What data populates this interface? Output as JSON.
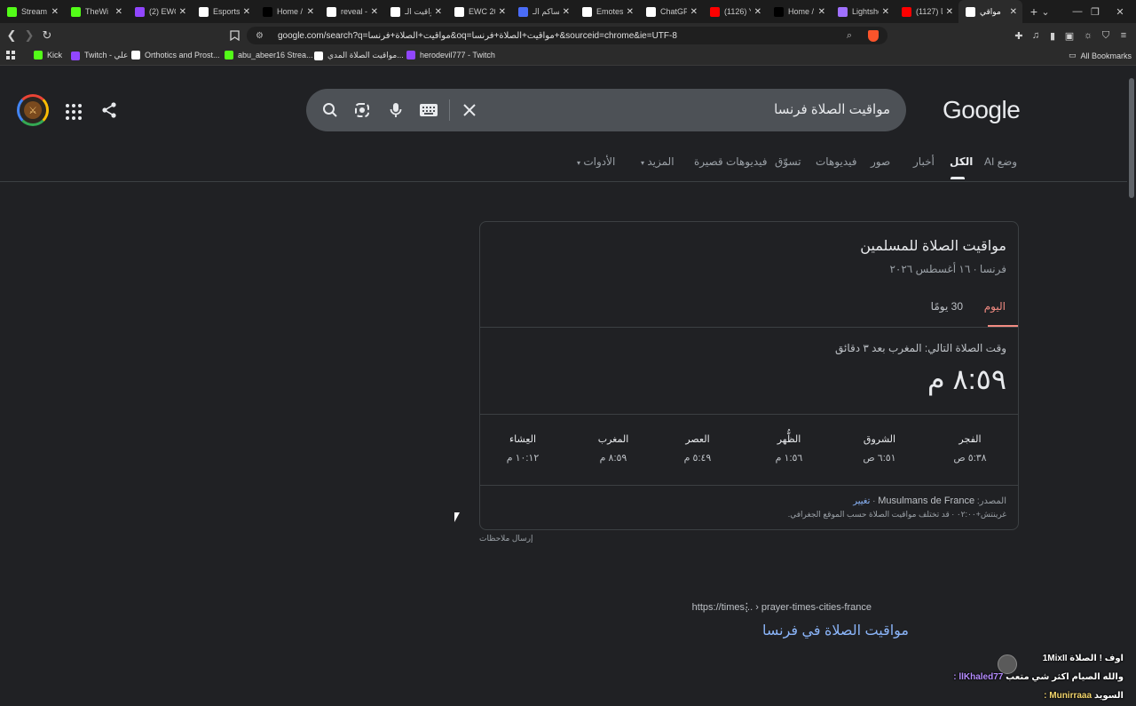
{
  "browser": {
    "tabs": [
      {
        "label": "Stream",
        "color": "#53fc18"
      },
      {
        "label": "TheWi",
        "color": "#53fc18"
      },
      {
        "label": "(2) EWC_s",
        "color": "#9146ff"
      },
      {
        "label": "Esports W",
        "color": "#ffffff"
      },
      {
        "label": "Home / X",
        "color": "#000000"
      },
      {
        "label": "reveal - Li",
        "color": "#ffffff"
      },
      {
        "label": "مواقيت الـ",
        "color": "#ffffff"
      },
      {
        "label": "EWC 2026",
        "color": "#ffffff"
      },
      {
        "label": "مساكم الـ",
        "color": "#4a6cf7"
      },
      {
        "label": "Emotes - I",
        "color": "#ffffff"
      },
      {
        "label": "ChatGPTIn",
        "color": "#ffffff"
      },
      {
        "label": "(1126) You",
        "color": "#ff0000"
      },
      {
        "label": "Home / X",
        "color": "#000000"
      },
      {
        "label": "Lightshot",
        "color": "#a070ff"
      },
      {
        "label": "(1127) ريا",
        "color": "#ff0000"
      },
      {
        "label": "مواقي",
        "color": "#ffffff"
      }
    ],
    "url": "google.com/search?q=مواقيت+الصلاة+فرنسا&oq=مواقيت+الصلاة+فرنسا+&sourceid=chrome&ie=UTF-8",
    "bookmarks": [
      {
        "label": "Kick",
        "color": "#53fc18"
      },
      {
        "label": "Twitch - علي",
        "color": "#9146ff"
      },
      {
        "label": "Orthotics and Prost...",
        "color": "#ffffff"
      },
      {
        "label": "abu_abeer16 Strea...",
        "color": "#53fc18"
      },
      {
        "label": "مواقيت الصلاة المدي...",
        "color": "#ffffff"
      },
      {
        "label": "herodevil777 - Twitch",
        "color": "#9146ff"
      }
    ],
    "all_bookmarks": "All Bookmarks"
  },
  "search": {
    "query": "مواقيت الصلاة فرنسا",
    "logo": "Google",
    "tabs": [
      "وضع AI",
      "الكل",
      "أخبار",
      "صور",
      "فيديوهات",
      "تسوّق",
      "فيديوهات قصيرة",
      "المزيد",
      "الأدوات"
    ]
  },
  "prayer": {
    "title": "مواقيت الصلاة للمسلمين",
    "subtitle": "فرنسا · ١٦ أغسطس ٢٠٢٦",
    "tab_today": "اليوم",
    "tab_30": "30 يومًا",
    "next_prayer": "وقت الصلاة التالي: المغرب بعد ٣ دقائق",
    "big_time": "٨:٥٩ م",
    "times": [
      {
        "name": "الفجر",
        "time": "٥:٣٨ ص"
      },
      {
        "name": "الشروق",
        "time": "٦:٥١ ص"
      },
      {
        "name": "الظُّهر",
        "time": "١:٥٦ م"
      },
      {
        "name": "العصر",
        "time": "٥:٤٩ م"
      },
      {
        "name": "المغرب",
        "time": "٨:٥٩ م"
      },
      {
        "name": "العِشاء",
        "time": "١٠:١٢ م"
      }
    ],
    "source_label": "المصدر:",
    "source_name": "Musulmans de France",
    "source_change": "تغيير",
    "note": "غرينتش+٠٢:٠٠ · قد تختلف مواقيت الصلاة حسب الموقع الجغرافي.",
    "feedback": "إرسال ملاحظات"
  },
  "result": {
    "url": "https://times... › prayer-times-cities-france",
    "title": "مواقيت الصلاة في فرنسا"
  },
  "chat": {
    "line1": "اوف ! الصلاة 1MixII",
    "line2_nick": "llKhaled77 :",
    "line2_msg": "والله الصيام اكثر شي متعب",
    "line3_nick": "Munirraaa :",
    "line3_msg": "السويد"
  }
}
